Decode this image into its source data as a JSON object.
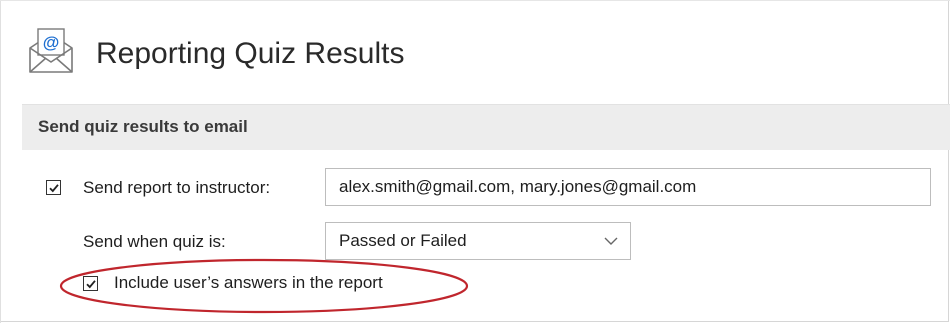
{
  "header": {
    "title": "Reporting Quiz Results",
    "icon": "email-icon"
  },
  "section": {
    "title": "Send quiz results to email"
  },
  "form": {
    "send_report": {
      "checked": true,
      "label": "Send report to instructor:",
      "value": "alex.smith@gmail.com, mary.jones@gmail.com"
    },
    "send_when": {
      "label": "Send when quiz is:",
      "selected": "Passed or Failed"
    },
    "include_answers": {
      "checked": true,
      "label": "Include user’s answers in the report"
    }
  },
  "colors": {
    "section_bg": "#ededed",
    "highlight": "#c0262d",
    "icon_blue": "#1e6fd1"
  }
}
